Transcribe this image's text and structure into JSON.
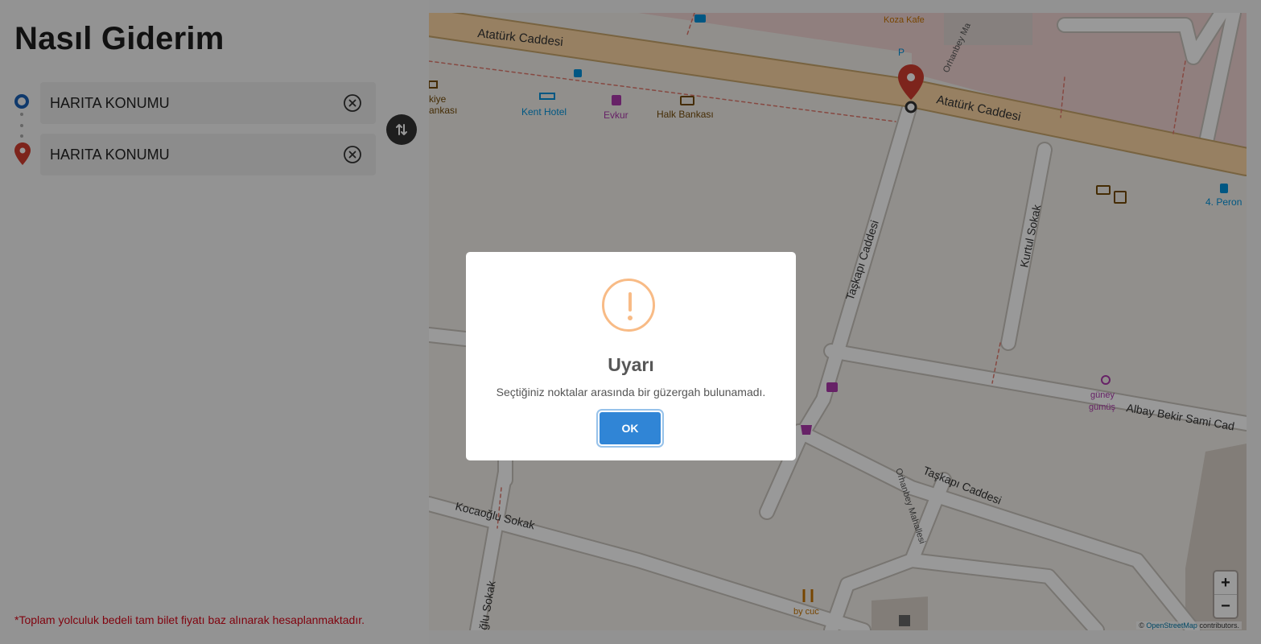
{
  "sidebar": {
    "title": "Nasıl Giderim",
    "from": {
      "value": "HARITA KONUMU"
    },
    "to": {
      "value": "HARITA KONUMU"
    },
    "footnote": "*Toplam yolculuk bedeli tam bilet fiyatı baz alınarak hesaplanmaktadır."
  },
  "map": {
    "labels": {
      "ataturk_west": "Atatürk Caddesi",
      "ataturk_east": "Atatürk Caddesi",
      "koza_kafe": "Koza Kafe",
      "kent_hotel": "Kent Hotel",
      "evkur": "Evkur",
      "halk_bankasi": "Halk Bankası",
      "bankasi_cut": "kiye",
      "bankasi_cut2": "ankası",
      "taskapi_north": "Taşkapı Caddesi",
      "taskapi_south": "Taşkapı Caddesi",
      "kurtul": "Kurtul Sokak",
      "albay": "Albay Bekir Sami Cad",
      "guney1": "güney",
      "guney2": "gümüş",
      "peron": "4. Peron",
      "kocaoglu": "Kocaoğlu Sokak",
      "oglu_sokak": "ğlu Sokak",
      "orhanbey_n": "Orhanbey Ma",
      "orhanbey_s": "Orhanbey Mahallesi",
      "bycuc": "by cuc",
      "parking": "P"
    },
    "zoom_in": "+",
    "zoom_out": "−",
    "attribution_prefix": "©",
    "attribution_link": "OpenStreetMap",
    "attribution_suffix": "contributors."
  },
  "dialog": {
    "title": "Uyarı",
    "message": "Seçtiğiniz noktalar arasında bir güzergah bulunamadı.",
    "ok_label": "OK"
  },
  "colors": {
    "accent": "#3085d6",
    "warning": "#f8bb86",
    "marker_red": "#d13c2f",
    "marker_blue": "#1a5fb4",
    "note_red": "#d6081a"
  }
}
